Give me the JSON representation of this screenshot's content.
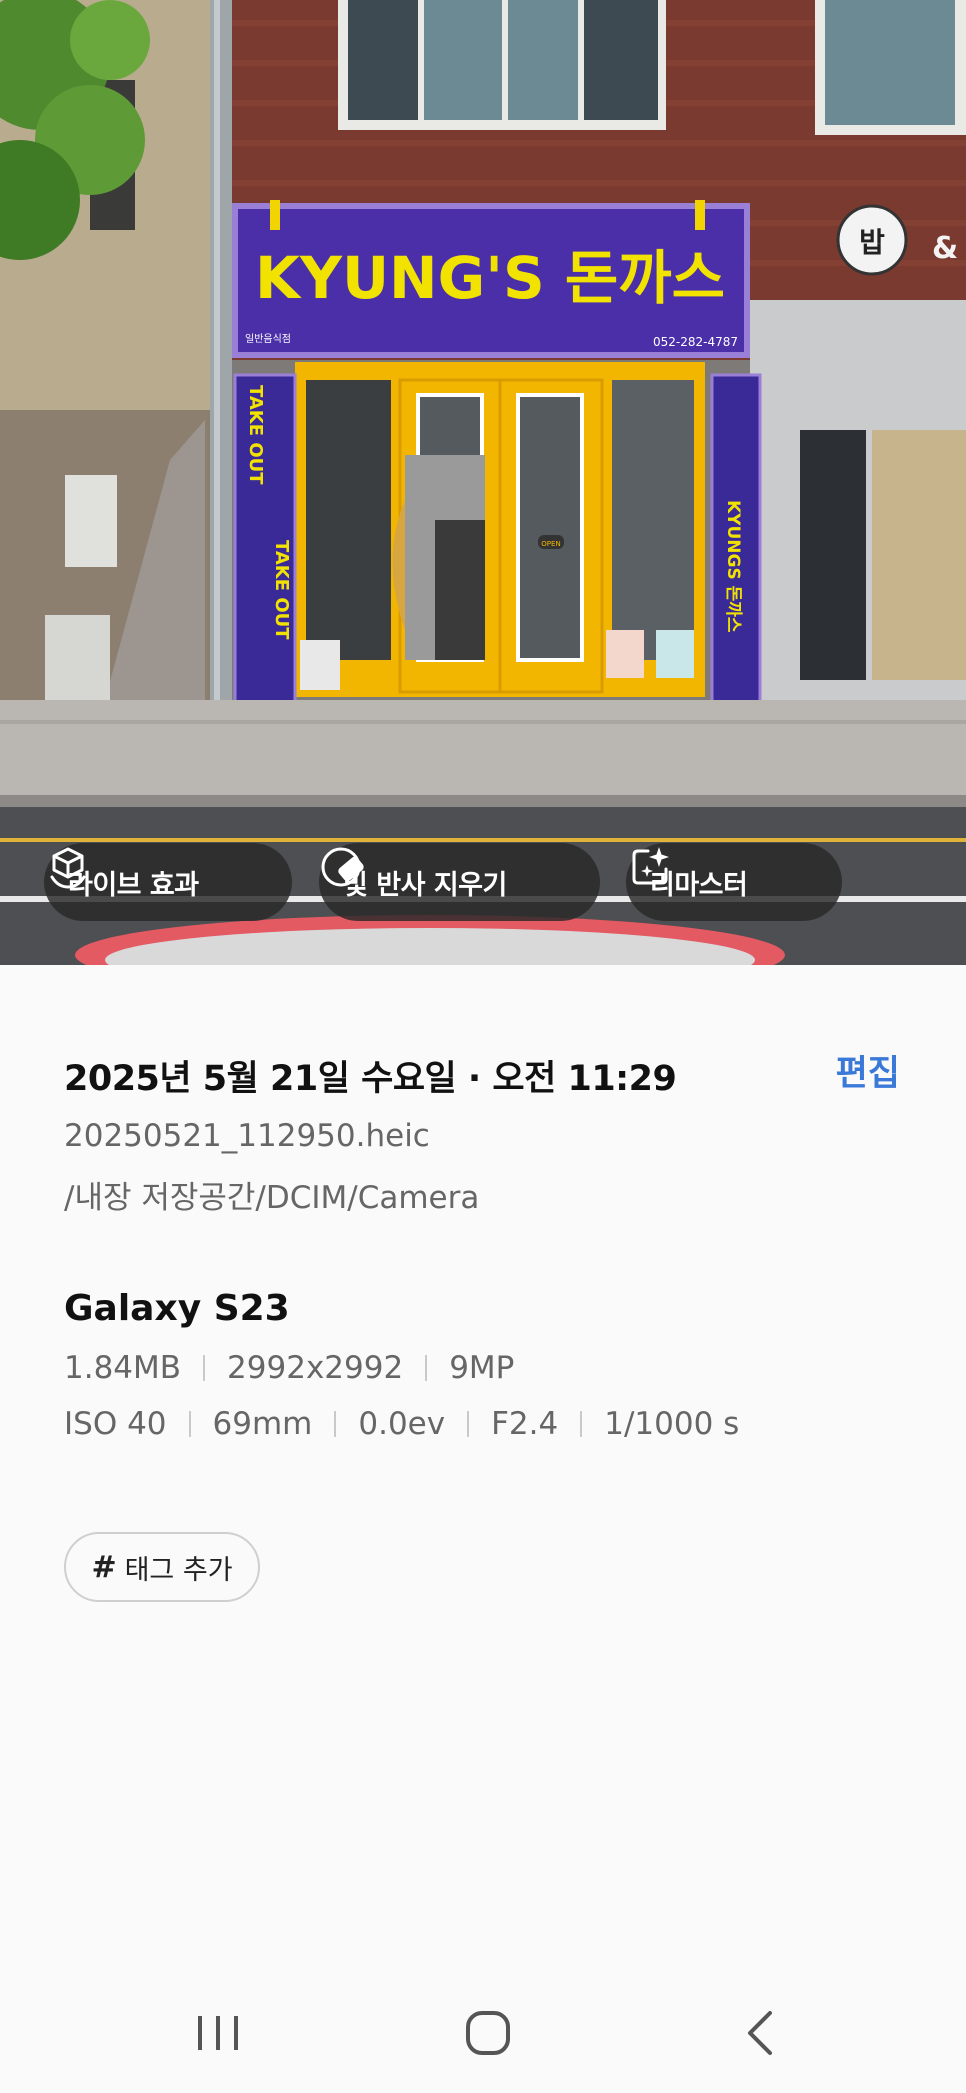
{
  "photo": {
    "sign": {
      "title": "KYUNG'S 돈까스",
      "category": "일반음식점",
      "phone": "052-282-4787",
      "left_banner_top": "TAKE OUT",
      "left_banner_bottom": "TAKE OUT",
      "right_banner": "KYUNGS 돈까스",
      "door_sign": "OPEN",
      "neighbor_sign": "밥"
    },
    "chips": {
      "live_label": "라이브 효과",
      "glare_label": "빛 반사 지우기",
      "remaster_label": "리마스터"
    }
  },
  "details": {
    "datetime": "2025년 5월 21일 수요일 · 오전 11:29",
    "edit_label": "편집",
    "filename": "20250521_112950.heic",
    "path": "/내장 저장공간/DCIM/Camera",
    "device": "Galaxy S23",
    "specs_row1": [
      "1.84MB",
      "2992x2992",
      "9MP"
    ],
    "specs_row2": [
      "ISO 40",
      "69mm",
      "0.0ev",
      "F2.4",
      "1/1000 s"
    ],
    "tag_label": "태그 추가"
  },
  "colors": {
    "accent": "#3a79d8",
    "sign_purple": "#4a2fa8",
    "storefront_yellow": "#f2b600"
  },
  "icons": {
    "live": "cube-sparkle-icon",
    "glare": "eraser-circle-icon",
    "remaster": "sparkle-frame-icon",
    "tag": "hash-icon",
    "nav_recents": "recents-icon",
    "nav_home": "home-icon",
    "nav_back": "back-icon"
  }
}
